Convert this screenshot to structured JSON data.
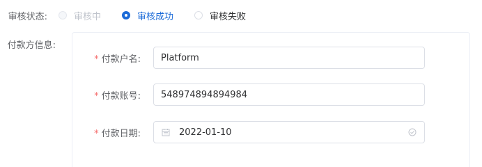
{
  "review_status": {
    "label": "审核状态:",
    "options": [
      {
        "label": "审核中",
        "state": "disabled"
      },
      {
        "label": "审核成功",
        "state": "checked"
      },
      {
        "label": "审核失败",
        "state": "unchecked"
      }
    ]
  },
  "payer_info": {
    "label": "付款方信息:",
    "required_mark": "*",
    "fields": {
      "name": {
        "label": "付款户名:",
        "value": "Platform"
      },
      "account": {
        "label": "付款账号:",
        "value": "548974894894984"
      },
      "date": {
        "label": "付款日期:",
        "value": "2022-01-10"
      }
    }
  },
  "colors": {
    "accent": "#1c6bd8",
    "required": "#f56c6c",
    "border": "#dcdfe6",
    "label": "#606266"
  },
  "icons": {
    "date_left": "calendar-icon",
    "date_right": "circle-check-icon"
  }
}
